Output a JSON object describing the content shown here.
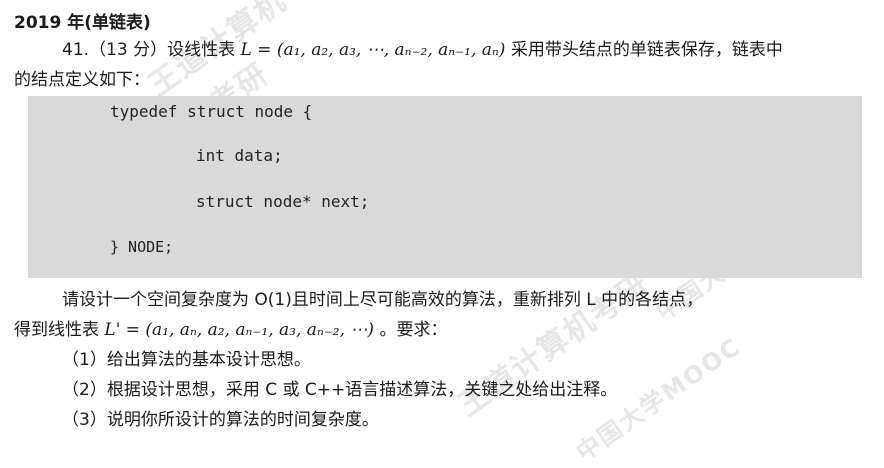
{
  "heading": "2019 年(单链表)",
  "question": {
    "line1_prefix": "41.（13 分）设线性表",
    "line1_math": "L = (a₁, a₂, a₃, ⋯, aₙ₋₂, aₙ₋₁, aₙ)",
    "line1_suffix": "采用带头结点的单链表保存，链表中",
    "line2": "的结点定义如下："
  },
  "code": {
    "line1": "typedef struct node {",
    "line2": "int data;",
    "line3": "struct node* next;",
    "line4": "} NODE;"
  },
  "body": {
    "line1": "请设计一个空间复杂度为 O(1)且时间上尽可能高效的算法，重新排列 L 中的各结点，",
    "line2_prefix": "得到线性表",
    "line2_math": "L' = (a₁, aₙ, a₂, aₙ₋₁, a₃, aₙ₋₂, ⋯)",
    "line2_suffix": "。要求：",
    "req1": "（1）给出算法的基本设计思想。",
    "req2": "（2）根据设计思想，采用 C 或 C++语言描述算法，关键之处给出注释。",
    "req3": "（3）说明你所设计的算法的时间复杂度。"
  },
  "watermark": {
    "text1": "王道计算机考研",
    "text2": "中国大学MOOC"
  }
}
